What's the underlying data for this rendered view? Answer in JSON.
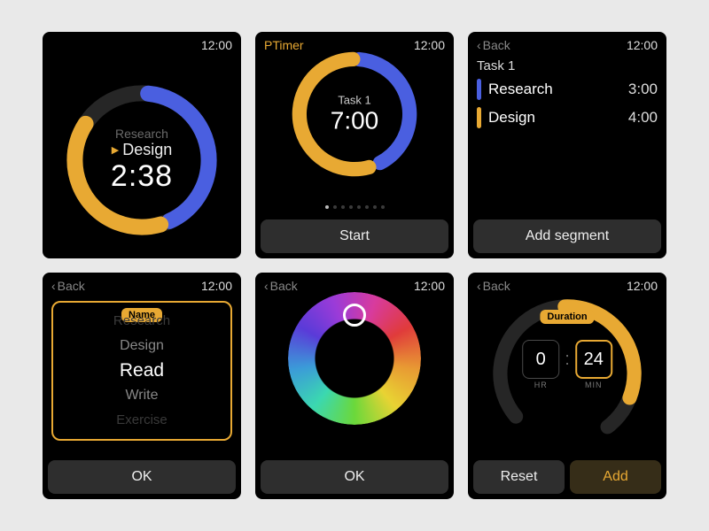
{
  "shared": {
    "clock": "12:00",
    "back_label": "Back"
  },
  "screen1": {
    "prev_task": "Research",
    "current_task": "Design",
    "time": "2:38"
  },
  "screen2": {
    "app_title": "PTimer",
    "task": "Task 1",
    "time": "7:00",
    "start_label": "Start",
    "page_index": 0,
    "page_count": 8
  },
  "screen3": {
    "title": "Task 1",
    "segments": [
      {
        "name": "Research",
        "time": "3:00",
        "color": "#4a5fe0"
      },
      {
        "name": "Design",
        "time": "4:00",
        "color": "#e8a933"
      }
    ],
    "add_label": "Add segment"
  },
  "screen4": {
    "picker_label": "Name",
    "options": [
      "Research",
      "Design",
      "Read",
      "Write",
      "Exercise"
    ],
    "selected_index": 2,
    "ok_label": "OK"
  },
  "screen5": {
    "ok_label": "OK"
  },
  "screen6": {
    "picker_label": "Duration",
    "hours": "0",
    "minutes": "24",
    "hr_label": "HR",
    "min_label": "MIN",
    "reset_label": "Reset",
    "add_label": "Add"
  }
}
